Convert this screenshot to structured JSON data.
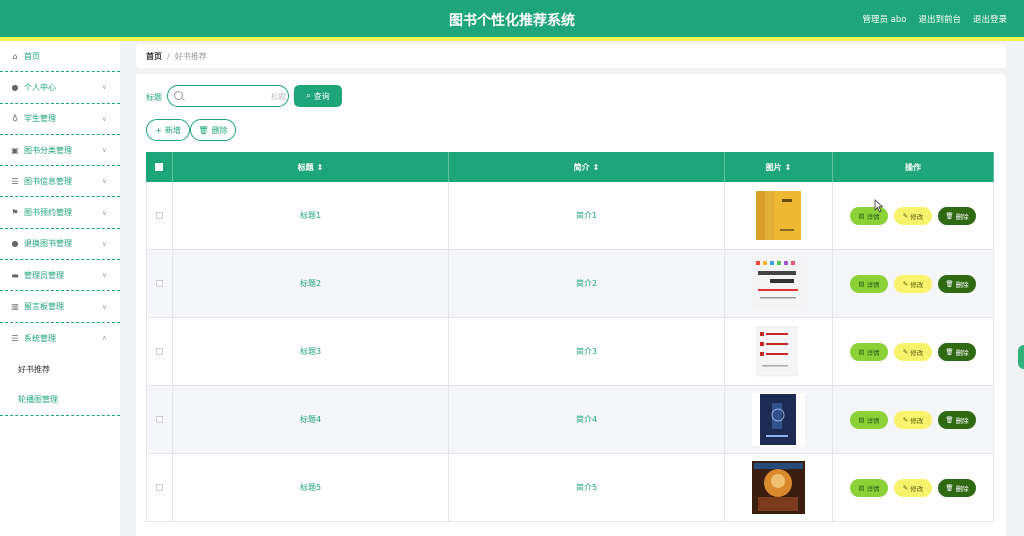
{
  "header": {
    "title": "图书个性化推荐系统",
    "links": [
      "管理员 abo",
      "退出到前台",
      "退出登录"
    ]
  },
  "sidebar": {
    "items": [
      {
        "label": "首页",
        "icon": "home-icon",
        "chevron": false
      },
      {
        "label": "个人中心",
        "icon": "user-icon",
        "chevron": true
      },
      {
        "label": "学生管理",
        "icon": "mic-icon",
        "chevron": true
      },
      {
        "label": "图书分类管理",
        "icon": "picture-icon",
        "chevron": true
      },
      {
        "label": "图书信息管理",
        "icon": "list-icon",
        "chevron": true
      },
      {
        "label": "图书预约管理",
        "icon": "flag-icon",
        "chevron": true
      },
      {
        "label": "退换图书管理",
        "icon": "user-icon",
        "chevron": true
      },
      {
        "label": "管理员管理",
        "icon": "monitor-icon",
        "chevron": true
      },
      {
        "label": "留言板管理",
        "icon": "bar-chart-icon",
        "chevron": true
      },
      {
        "label": "系统管理",
        "icon": "list-icon",
        "chevron": true,
        "open": true
      }
    ],
    "subitems": [
      "好书推荐",
      "轮播图管理"
    ]
  },
  "breadcrumb": {
    "home": "首页",
    "separator": "/",
    "current": "好书推荐"
  },
  "search": {
    "label": "标题",
    "placeholder": "标题",
    "button": "查询"
  },
  "actions": {
    "add": "新增",
    "delete": "删除"
  },
  "table": {
    "headers": {
      "title": "标题",
      "intro": "简介",
      "image": "图片",
      "ops": "操作"
    },
    "rows": [
      {
        "title": "标题1",
        "intro": "简介1",
        "cover": "yellow"
      },
      {
        "title": "标题2",
        "intro": "简介2",
        "cover": "white-decision"
      },
      {
        "title": "标题3",
        "intro": "简介3",
        "cover": "white-red"
      },
      {
        "title": "标题4",
        "intro": "简介4",
        "cover": "navy"
      },
      {
        "title": "标题5",
        "intro": "简介5",
        "cover": "colorful"
      }
    ],
    "op_labels": {
      "detail": "详情",
      "edit": "修改",
      "delete": "删除"
    }
  },
  "colors": {
    "primary": "#1fa57a",
    "strip": "#f2f54b",
    "detail": "#8bd137",
    "edit": "#f8f36b",
    "del": "#2f6a12"
  }
}
